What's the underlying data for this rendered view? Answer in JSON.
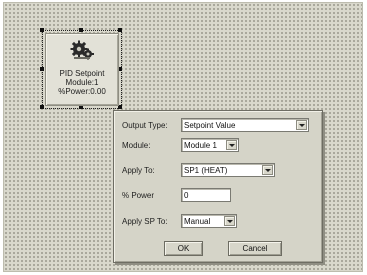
{
  "block": {
    "title": "PID Setpoint",
    "module": "Module:1",
    "power": "%Power:0.00",
    "icon": "gears-icon"
  },
  "dialog": {
    "output_type": {
      "label": "Output Type:",
      "value": "Setpoint Value"
    },
    "module": {
      "label": "Module:",
      "value": "Module 1"
    },
    "apply_to": {
      "label": "Apply To:",
      "value": "SP1 (HEAT)"
    },
    "power": {
      "label": "% Power",
      "value": "0"
    },
    "apply_sp_to": {
      "label": "Apply SP To:",
      "value": "Manual"
    },
    "ok_label": "OK",
    "cancel_label": "Cancel"
  }
}
